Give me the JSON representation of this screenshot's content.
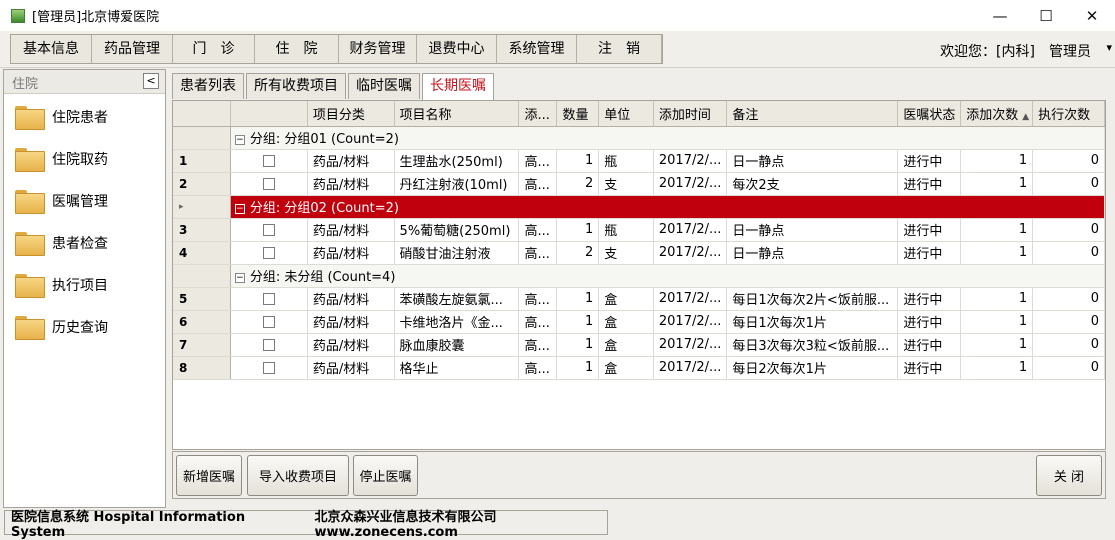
{
  "window": {
    "title": "[管理员]北京博爱医院"
  },
  "menu": {
    "items": [
      "基本信息",
      "药品管理",
      "门　诊",
      "住　院",
      "财务管理",
      "退费中心",
      "系统管理",
      "注　销"
    ],
    "welcome": "欢迎您：[内科]　管理员"
  },
  "sidebar": {
    "title": "住院",
    "items": [
      "住院患者",
      "住院取药",
      "医嘱管理",
      "患者检查",
      "执行项目",
      "历史查询"
    ]
  },
  "tabs": [
    "患者列表",
    "所有收费项目",
    "临时医嘱",
    "长期医嘱"
  ],
  "grid": {
    "columns": [
      "",
      "项目分类",
      "项目名称",
      "添...",
      "数量",
      "单位",
      "添加时间",
      "备注",
      "医嘱状态",
      "添加次数",
      "执行次数"
    ],
    "groups": [
      {
        "label": "分组: 分组01 (Count=2)",
        "rows": [
          {
            "no": "1",
            "category": "药品/材料",
            "name": "生理盐水(250ml)",
            "added_by": "高...",
            "qty": "1",
            "unit": "瓶",
            "time": "2017/2/...",
            "note": "日一静点",
            "status": "进行中",
            "add_count": "1",
            "exec_count": "0"
          },
          {
            "no": "2",
            "category": "药品/材料",
            "name": "丹红注射液(10ml)",
            "added_by": "高...",
            "qty": "2",
            "unit": "支",
            "time": "2017/2/...",
            "note": "每次2支",
            "status": "进行中",
            "add_count": "1",
            "exec_count": "0"
          }
        ]
      },
      {
        "label": "分组: 分组02 (Count=2)",
        "rows": [
          {
            "no": "3",
            "category": "药品/材料",
            "name": "5%葡萄糖(250ml)",
            "added_by": "高...",
            "qty": "1",
            "unit": "瓶",
            "time": "2017/2/...",
            "note": "日一静点",
            "status": "进行中",
            "add_count": "1",
            "exec_count": "0"
          },
          {
            "no": "4",
            "category": "药品/材料",
            "name": "硝酸甘油注射液",
            "added_by": "高...",
            "qty": "2",
            "unit": "支",
            "time": "2017/2/...",
            "note": "日一静点",
            "status": "进行中",
            "add_count": "1",
            "exec_count": "0"
          }
        ]
      },
      {
        "label": "分组: 未分组 (Count=4)",
        "rows": [
          {
            "no": "5",
            "category": "药品/材料",
            "name": "苯磺酸左旋氨氯...",
            "added_by": "高...",
            "qty": "1",
            "unit": "盒",
            "time": "2017/2/...",
            "note": "每日1次每次2片<饭前服...",
            "status": "进行中",
            "add_count": "1",
            "exec_count": "0"
          },
          {
            "no": "6",
            "category": "药品/材料",
            "name": "卡维地洛片《金...",
            "added_by": "高...",
            "qty": "1",
            "unit": "盒",
            "time": "2017/2/...",
            "note": "每日1次每次1片",
            "status": "进行中",
            "add_count": "1",
            "exec_count": "0"
          },
          {
            "no": "7",
            "category": "药品/材料",
            "name": "脉血康胶囊",
            "added_by": "高...",
            "qty": "1",
            "unit": "盒",
            "time": "2017/2/...",
            "note": "每日3次每次3粒<饭前服...",
            "status": "进行中",
            "add_count": "1",
            "exec_count": "0"
          },
          {
            "no": "8",
            "category": "药品/材料",
            "name": "格华止",
            "added_by": "高...",
            "qty": "1",
            "unit": "盒",
            "time": "2017/2/...",
            "note": "每日2次每次1片",
            "status": "进行中",
            "add_count": "1",
            "exec_count": "0"
          }
        ]
      }
    ]
  },
  "buttons": {
    "add": "新增医嘱",
    "import": "导入收费项目",
    "stop": "停止医嘱",
    "close": "关 闭"
  },
  "status": {
    "left": "医院信息系统 Hospital Information System",
    "right": "北京众森兴业信息技术有限公司  www.zonecens.com"
  },
  "colors": {
    "active_tab_text": "#c8141e",
    "selected_group_bg": "#c0000c"
  }
}
